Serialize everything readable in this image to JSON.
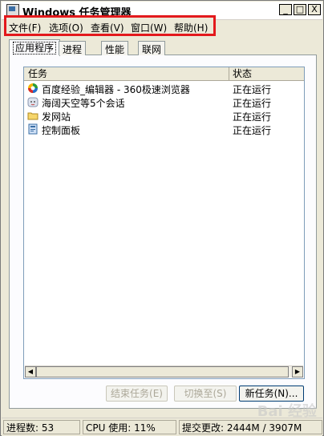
{
  "window": {
    "title": "Windows 任务管理器",
    "buttons": {
      "minimize": "_",
      "maximize": "□",
      "close": "X"
    }
  },
  "menu": {
    "items": [
      "文件(F)",
      "选项(O)",
      "查看(V)",
      "窗口(W)",
      "帮助(H)"
    ]
  },
  "tabs": [
    "应用程序",
    "进程",
    "性能",
    "联网"
  ],
  "list": {
    "columns": {
      "task": "任务",
      "status": "状态"
    },
    "rows": [
      {
        "name": "百度经验_编辑器 - 360极速浏览器",
        "status": "正在运行",
        "icon": "browser-icon"
      },
      {
        "name": "海阔天空等5个会话",
        "status": "正在运行",
        "icon": "chat-icon"
      },
      {
        "name": "发网站",
        "status": "正在运行",
        "icon": "folder-icon"
      },
      {
        "name": "控制面板",
        "status": "正在运行",
        "icon": "control-panel-icon"
      }
    ]
  },
  "buttons": {
    "end_task": "结束任务(E)",
    "switch_to": "切换至(S)",
    "new_task": "新任务(N)..."
  },
  "statusbar": {
    "processes": "进程数: 53",
    "cpu": "CPU 使用: 11%",
    "commit": "提交更改: 2444M / 3907M"
  },
  "watermark": "Bai 经验",
  "colors": {
    "highlight_border": "#e3191c",
    "window_bg": "#ece9d8"
  }
}
